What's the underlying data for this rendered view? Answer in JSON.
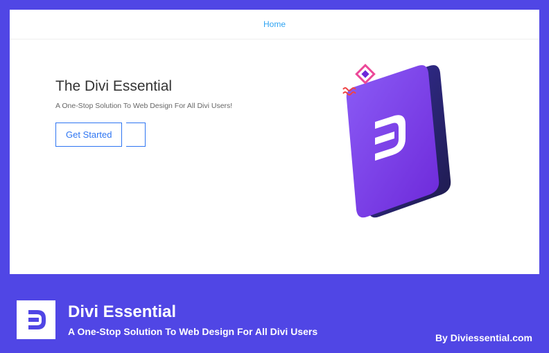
{
  "nav": {
    "home": "Home"
  },
  "hero": {
    "title": "The Divi Essential",
    "subtitle": "A One-Stop Solution To Web Design For All Divi Users!",
    "cta": "Get Started"
  },
  "footer": {
    "title": "Divi Essential",
    "subtitle": "A One-Stop Solution To Web Design For All Divi Users",
    "author": "By Diviessential.com"
  }
}
